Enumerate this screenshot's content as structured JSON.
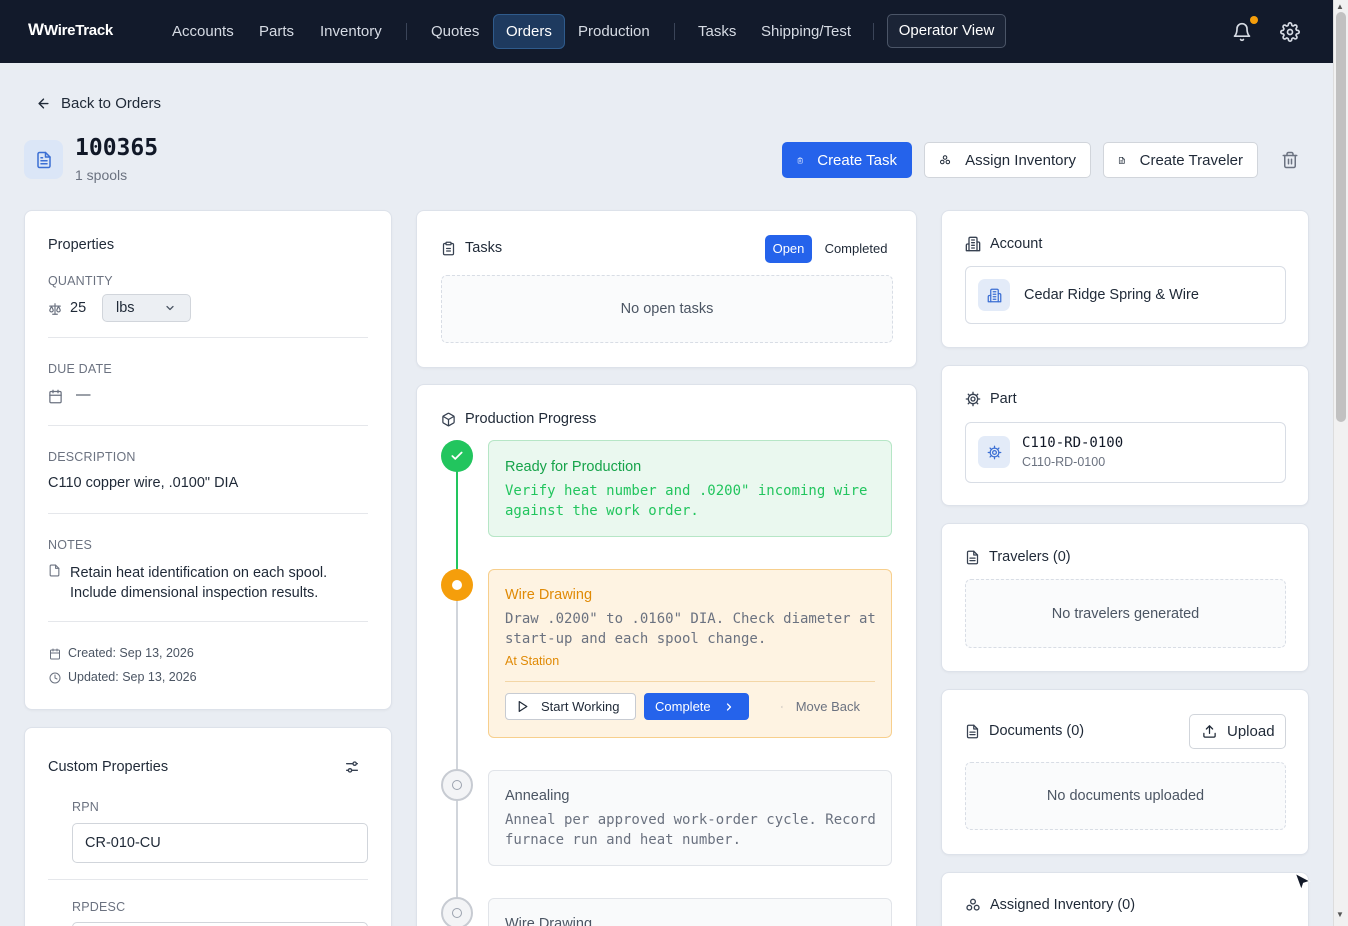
{
  "nav": {
    "logo": "WireTrack",
    "items": [
      "Accounts",
      "Parts",
      "Inventory",
      "Quotes",
      "Orders",
      "Production",
      "Tasks",
      "Shipping/Test"
    ],
    "active": "Orders",
    "operator_view": "Operator View"
  },
  "header": {
    "back": "Back to Orders",
    "order_number": "100365",
    "subtitle": "1 spools",
    "create_task": "Create Task",
    "assign_inventory": "Assign Inventory",
    "create_traveler": "Create Traveler"
  },
  "properties": {
    "title": "Properties",
    "quantity_label": "QUANTITY",
    "quantity_value": "25",
    "quantity_unit": "lbs",
    "due_date_label": "DUE DATE",
    "due_date_value": "—",
    "description_label": "DESCRIPTION",
    "description_value": "C110 copper wire, .0100\" DIA",
    "notes_label": "NOTES",
    "notes_line1": "Retain heat identification on each spool.",
    "notes_line2": "Include dimensional inspection results.",
    "created": "Created: Sep 13, 2026",
    "updated": "Updated: Sep 13, 2026"
  },
  "custom_properties": {
    "title": "Custom Properties",
    "rpn_label": "RPN",
    "rpn_value": "CR-010-CU",
    "rpdesc_label": "RPDESC"
  },
  "tasks": {
    "title": "Tasks",
    "tab_open": "Open",
    "tab_completed": "Completed",
    "empty": "No open tasks"
  },
  "production": {
    "title": "Production Progress",
    "stages": [
      {
        "title": "Ready for Production",
        "line1": "Verify heat number and .0200\" incoming wire",
        "line2": "against the work order.",
        "status": "complete"
      },
      {
        "title": "Wire Drawing",
        "line1": "Draw .0200\" to .0160\" DIA. Check diameter at",
        "line2": "start-up and each spool change.",
        "status_text": "At Station",
        "status": "current",
        "start_working": "Start Working",
        "complete": "Complete",
        "move_back": "Move Back"
      },
      {
        "title": "Annealing",
        "line1": "Anneal per approved work-order cycle. Record",
        "line2": "furnace run and heat number.",
        "status": "pending"
      },
      {
        "title": "Wire Drawing",
        "status": "pending"
      }
    ]
  },
  "account": {
    "title": "Account",
    "name": "Cedar Ridge Spring & Wire"
  },
  "part": {
    "title": "Part",
    "number": "C110-RD-0100",
    "sub": "C110-RD-0100"
  },
  "travelers": {
    "title": "Travelers (0)",
    "empty": "No travelers generated"
  },
  "documents": {
    "title": "Documents (0)",
    "upload": "Upload",
    "empty": "No documents uploaded"
  },
  "assigned_inventory": {
    "title": "Assigned Inventory (0)"
  },
  "colors": {
    "nav_bg": "#121a2b",
    "primary": "#2563eb",
    "success": "#22c55e",
    "warning": "#f59e0b",
    "notification_dot": "#f59e0b"
  }
}
